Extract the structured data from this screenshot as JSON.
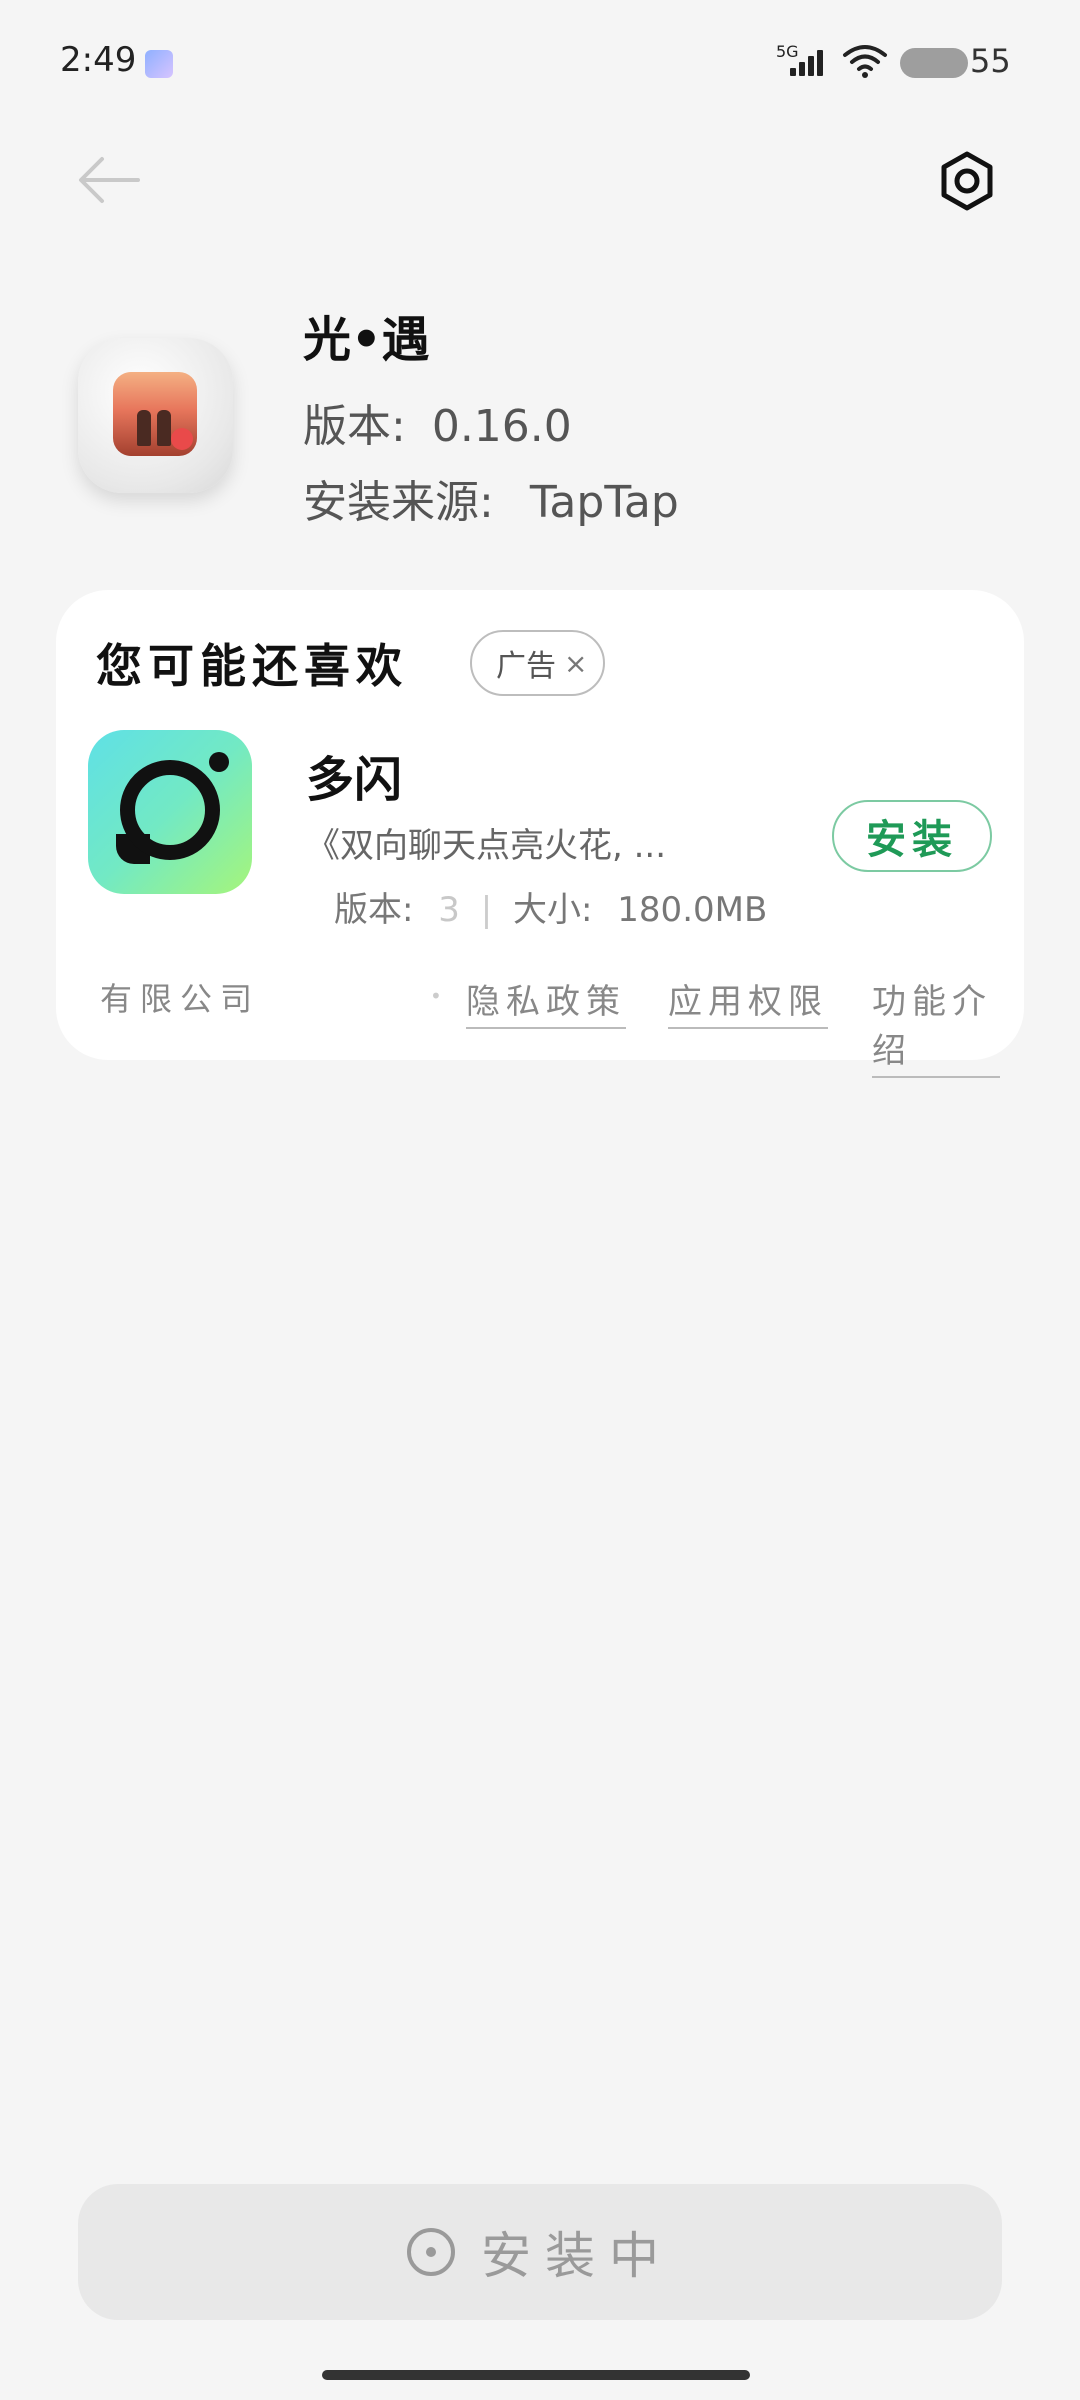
{
  "status_bar": {
    "time": "2:49",
    "network": "5G",
    "battery": "55"
  },
  "header": {
    "back_icon": "arrow-left-icon",
    "settings_icon": "settings-hexagon-icon"
  },
  "app": {
    "name": "光•遇",
    "version_label": "版本:",
    "version": "0.16.0",
    "source_label": "安装来源:",
    "source": "TapTap"
  },
  "recommendation": {
    "title": "您可能还喜欢",
    "ad_tag": "广告",
    "ad_close": "×",
    "item": {
      "name": "多闪",
      "description": "《双向聊天点亮火花, ...",
      "version_label": "版本:",
      "version": "3",
      "size_label": "大小:",
      "size": "180.0MB",
      "install_label": "安装"
    },
    "footer": {
      "company": "有限公司",
      "privacy": "隐私政策",
      "permissions": "应用权限",
      "features": "功能介绍"
    }
  },
  "bottom": {
    "installing_label": "安装中"
  },
  "colors": {
    "install_green": "#1f9a57",
    "card_bg": "#ffffff",
    "page_bg": "#f5f5f5"
  }
}
